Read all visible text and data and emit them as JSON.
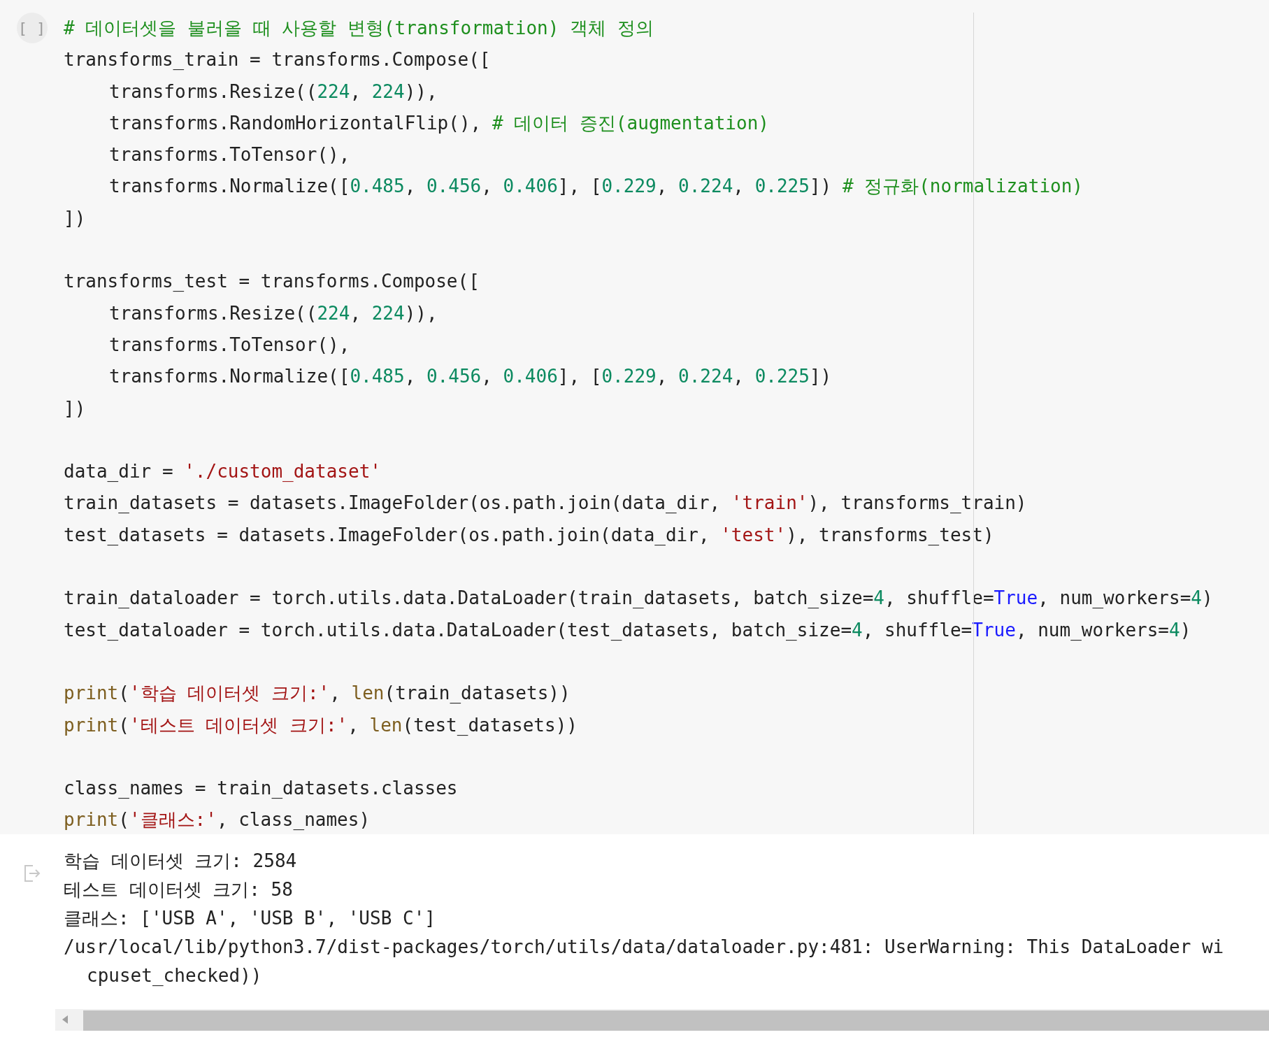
{
  "cell": {
    "run_label": "[ ]",
    "code_lines": [
      {
        "kind": "plain",
        "tokens": [
          {
            "kind": "comment",
            "text": "# 데이터셋을 불러올 때 사용할 변형(transformation) 객체 정의"
          }
        ]
      },
      {
        "kind": "plain",
        "tokens": [
          {
            "kind": "text",
            "text": "transforms_train = transforms.Compose(["
          }
        ]
      },
      {
        "kind": "indented",
        "tokens": [
          {
            "kind": "text",
            "text": "transforms.Resize(("
          },
          {
            "kind": "number",
            "text": "224"
          },
          {
            "kind": "text",
            "text": ", "
          },
          {
            "kind": "number",
            "text": "224"
          },
          {
            "kind": "text",
            "text": ")),"
          }
        ]
      },
      {
        "kind": "indented",
        "tokens": [
          {
            "kind": "text",
            "text": "transforms.RandomHorizontalFlip(), "
          },
          {
            "kind": "comment",
            "text": "# 데이터 증진(augmentation)"
          }
        ]
      },
      {
        "kind": "indented",
        "tokens": [
          {
            "kind": "text",
            "text": "transforms.ToTensor(),"
          }
        ]
      },
      {
        "kind": "indented",
        "tokens": [
          {
            "kind": "text",
            "text": "transforms.Normalize(["
          },
          {
            "kind": "number",
            "text": "0.485"
          },
          {
            "kind": "text",
            "text": ", "
          },
          {
            "kind": "number",
            "text": "0.456"
          },
          {
            "kind": "text",
            "text": ", "
          },
          {
            "kind": "number",
            "text": "0.406"
          },
          {
            "kind": "text",
            "text": "], ["
          },
          {
            "kind": "number",
            "text": "0.229"
          },
          {
            "kind": "text",
            "text": ", "
          },
          {
            "kind": "number",
            "text": "0.224"
          },
          {
            "kind": "text",
            "text": ", "
          },
          {
            "kind": "number",
            "text": "0.225"
          },
          {
            "kind": "text",
            "text": "]) "
          },
          {
            "kind": "comment",
            "text": "# 정규화(normalization)"
          }
        ]
      },
      {
        "kind": "plain",
        "tokens": [
          {
            "kind": "text",
            "text": "])"
          }
        ]
      },
      {
        "kind": "blank"
      },
      {
        "kind": "plain",
        "tokens": [
          {
            "kind": "text",
            "text": "transforms_test = transforms.Compose(["
          }
        ]
      },
      {
        "kind": "indented",
        "tokens": [
          {
            "kind": "text",
            "text": "transforms.Resize(("
          },
          {
            "kind": "number",
            "text": "224"
          },
          {
            "kind": "text",
            "text": ", "
          },
          {
            "kind": "number",
            "text": "224"
          },
          {
            "kind": "text",
            "text": ")),"
          }
        ]
      },
      {
        "kind": "indented",
        "tokens": [
          {
            "kind": "text",
            "text": "transforms.ToTensor(),"
          }
        ]
      },
      {
        "kind": "indented",
        "tokens": [
          {
            "kind": "text",
            "text": "transforms.Normalize(["
          },
          {
            "kind": "number",
            "text": "0.485"
          },
          {
            "kind": "text",
            "text": ", "
          },
          {
            "kind": "number",
            "text": "0.456"
          },
          {
            "kind": "text",
            "text": ", "
          },
          {
            "kind": "number",
            "text": "0.406"
          },
          {
            "kind": "text",
            "text": "], ["
          },
          {
            "kind": "number",
            "text": "0.229"
          },
          {
            "kind": "text",
            "text": ", "
          },
          {
            "kind": "number",
            "text": "0.224"
          },
          {
            "kind": "text",
            "text": ", "
          },
          {
            "kind": "number",
            "text": "0.225"
          },
          {
            "kind": "text",
            "text": "])"
          }
        ]
      },
      {
        "kind": "plain",
        "tokens": [
          {
            "kind": "text",
            "text": "])"
          }
        ]
      },
      {
        "kind": "blank"
      },
      {
        "kind": "plain",
        "tokens": [
          {
            "kind": "text",
            "text": "data_dir = "
          },
          {
            "kind": "string",
            "text": "'./custom_dataset'"
          }
        ]
      },
      {
        "kind": "plain",
        "tokens": [
          {
            "kind": "text",
            "text": "train_datasets = datasets.ImageFolder(os.path.join(data_dir, "
          },
          {
            "kind": "string",
            "text": "'train'"
          },
          {
            "kind": "text",
            "text": "), transforms_train)"
          }
        ]
      },
      {
        "kind": "plain",
        "tokens": [
          {
            "kind": "text",
            "text": "test_datasets = datasets.ImageFolder(os.path.join(data_dir, "
          },
          {
            "kind": "string",
            "text": "'test'"
          },
          {
            "kind": "text",
            "text": "), transforms_test)"
          }
        ]
      },
      {
        "kind": "blank"
      },
      {
        "kind": "plain",
        "tokens": [
          {
            "kind": "text",
            "text": "train_dataloader = torch.utils.data.DataLoader(train_datasets, batch_size="
          },
          {
            "kind": "number",
            "text": "4"
          },
          {
            "kind": "text",
            "text": ", shuffle="
          },
          {
            "kind": "keyword",
            "text": "True"
          },
          {
            "kind": "text",
            "text": ", num_workers="
          },
          {
            "kind": "number",
            "text": "4"
          },
          {
            "kind": "text",
            "text": ")"
          }
        ]
      },
      {
        "kind": "plain",
        "tokens": [
          {
            "kind": "text",
            "text": "test_dataloader = torch.utils.data.DataLoader(test_datasets, batch_size="
          },
          {
            "kind": "number",
            "text": "4"
          },
          {
            "kind": "text",
            "text": ", shuffle="
          },
          {
            "kind": "keyword",
            "text": "True"
          },
          {
            "kind": "text",
            "text": ", num_workers="
          },
          {
            "kind": "number",
            "text": "4"
          },
          {
            "kind": "text",
            "text": ")"
          }
        ]
      },
      {
        "kind": "blank"
      },
      {
        "kind": "plain",
        "tokens": [
          {
            "kind": "builtin",
            "text": "print"
          },
          {
            "kind": "text",
            "text": "("
          },
          {
            "kind": "string",
            "text": "'학습 데이터셋 크기:'"
          },
          {
            "kind": "text",
            "text": ", "
          },
          {
            "kind": "builtin",
            "text": "len"
          },
          {
            "kind": "text",
            "text": "(train_datasets))"
          }
        ]
      },
      {
        "kind": "plain",
        "tokens": [
          {
            "kind": "builtin",
            "text": "print"
          },
          {
            "kind": "text",
            "text": "("
          },
          {
            "kind": "string",
            "text": "'테스트 데이터셋 크기:'"
          },
          {
            "kind": "text",
            "text": ", "
          },
          {
            "kind": "builtin",
            "text": "len"
          },
          {
            "kind": "text",
            "text": "(test_datasets))"
          }
        ]
      },
      {
        "kind": "blank"
      },
      {
        "kind": "plain",
        "tokens": [
          {
            "kind": "text",
            "text": "class_names = train_datasets.classes"
          }
        ]
      },
      {
        "kind": "plain",
        "tokens": [
          {
            "kind": "builtin",
            "text": "print"
          },
          {
            "kind": "text",
            "text": "("
          },
          {
            "kind": "string",
            "text": "'클래스:'"
          },
          {
            "kind": "text",
            "text": ", class_names)"
          }
        ]
      }
    ],
    "output_lines": [
      {
        "kind": "plain",
        "text": "학습 데이터셋 크기: 2584"
      },
      {
        "kind": "plain",
        "text": "테스트 데이터셋 크기: 58"
      },
      {
        "kind": "plain",
        "text": "클래스: ['USB A', 'USB B', 'USB C']"
      },
      {
        "kind": "plain",
        "text": "/usr/local/lib/python3.7/dist-packages/torch/utils/data/dataloader.py:481: UserWarning: This DataLoader wi"
      },
      {
        "kind": "continued",
        "text": "cpuset_checked))"
      }
    ]
  }
}
